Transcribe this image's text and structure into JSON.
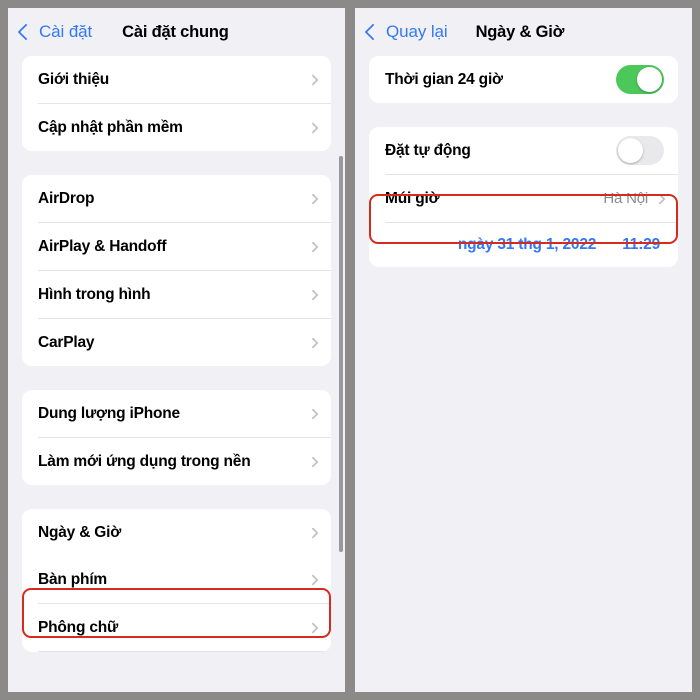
{
  "left_panel": {
    "nav": {
      "back_label": "Cài đặt",
      "title": "Cài đặt chung"
    },
    "groups": [
      {
        "rows": [
          {
            "label": "Giới thiệu",
            "accessory": "chevron"
          },
          {
            "label": "Cập nhật phần mềm",
            "accessory": "chevron"
          }
        ]
      },
      {
        "rows": [
          {
            "label": "AirDrop",
            "accessory": "chevron"
          },
          {
            "label": "AirPlay & Handoff",
            "accessory": "chevron"
          },
          {
            "label": "Hình trong hình",
            "accessory": "chevron"
          },
          {
            "label": "CarPlay",
            "accessory": "chevron"
          }
        ]
      },
      {
        "rows": [
          {
            "label": "Dung lượng iPhone",
            "accessory": "chevron"
          },
          {
            "label": "Làm mới ứng dụng trong nền",
            "accessory": "chevron"
          }
        ]
      },
      {
        "rows": [
          {
            "label": "Ngày & Giờ",
            "accessory": "chevron",
            "highlighted": true
          },
          {
            "label": "Bàn phím",
            "accessory": "chevron"
          },
          {
            "label": "Phông chữ",
            "accessory": "chevron"
          }
        ]
      }
    ]
  },
  "right_panel": {
    "nav": {
      "back_label": "Quay lại",
      "title": "Ngày & Giờ"
    },
    "rows": {
      "time24": {
        "label": "Thời gian 24 giờ",
        "toggle_state": "on"
      },
      "auto": {
        "label": "Đặt tự động",
        "toggle_state": "off",
        "highlighted": true
      },
      "timezone": {
        "label": "Múi giờ",
        "value": "Hà Nội",
        "accessory": "chevron"
      },
      "datetime": {
        "date": "ngày 31 thg 1, 2022",
        "time": "11:29"
      }
    }
  },
  "colors": {
    "accent_blue": "#3478f6",
    "toggle_on_green": "#4cc75a",
    "toggle_off_gray": "#e9e9eb",
    "highlight_red": "#d52b1e",
    "panel_bg": "#f0f0f5",
    "card_bg": "#ffffff",
    "chevron_gray": "#c2c2c7",
    "secondary_text": "#8a8a8e",
    "frame_gray": "#8c8a88"
  }
}
